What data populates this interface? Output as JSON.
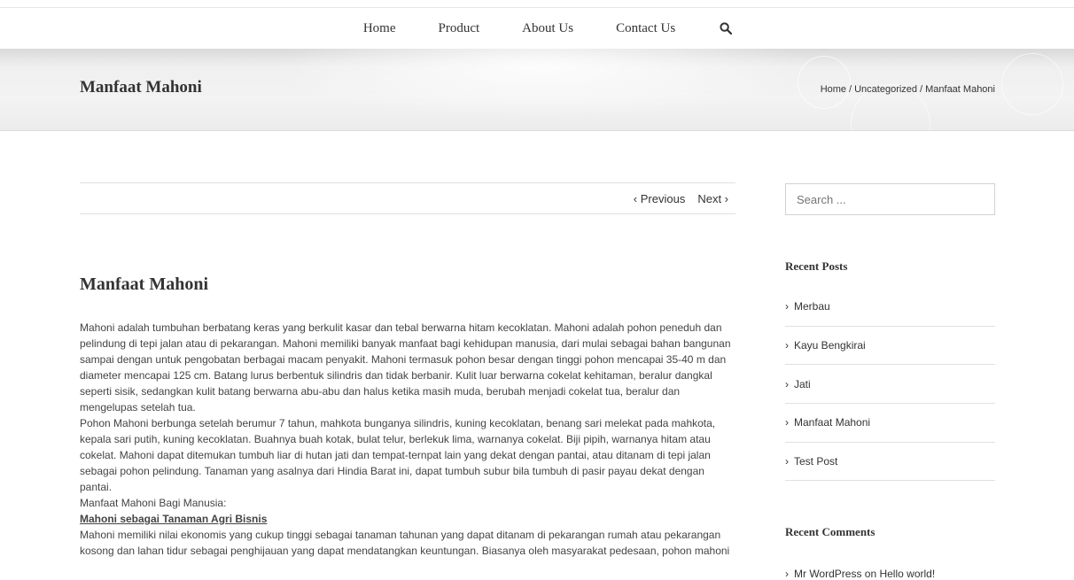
{
  "nav": {
    "items": [
      "Home",
      "Product",
      "About Us",
      "Contact Us"
    ],
    "search_icon": "search-icon"
  },
  "header": {
    "title": "Manfaat Mahoni",
    "breadcrumb": [
      "Home",
      "Uncategorized",
      "Manfaat Mahoni"
    ],
    "separator": "/"
  },
  "postnav": {
    "previous": "‹ Previous",
    "next": "Next ›"
  },
  "post": {
    "title": "Manfaat Mahoni",
    "paragraph1": "Mahoni adalah tumbuhan berbatang keras yang berkulit kasar dan tebal berwarna hitam kecoklatan. Mahoni adalah pohon peneduh dan pelindung di tepi jalan atau di pekarangan. Mahoni memiliki banyak manfaat bagi kehidupan manusia, dari mulai sebagai bahan bangunan sampai dengan untuk pengobatan berbagai macam penyakit. Mahoni termasuk pohon besar dengan tinggi pohon mencapai 35-40 m dan diameter mencapai 125 cm. Batang lurus berbentuk silindris dan tidak berbanir. Kulit luar berwarna cokelat kehitaman, beralur dangkal seperti sisik, sedangkan kulit batang berwarna abu-abu dan halus ketika masih muda, berubah menjadi cokelat tua, beralur dan mengelupas setelah tua.",
    "paragraph2": "Pohon Mahoni berbunga setelah berumur 7 tahun, mahkota bunganya silindris, kuning kecoklatan, benang sari melekat pada mahkota, kepala sari putih, kuning kecoklatan. Buahnya buah kotak, bulat telur, berlekuk lima, warnanya cokelat. Biji pipih, warnanya hitam atau cokelat. Mahoni dapat ditemukan tumbuh liar di hutan jati dan tempat-ternpat lain yang dekat dengan pantai, atau ditanam di tepi jalan sebagai pohon pelindung. Tanaman yang asalnya dari Hindia Barat ini, dapat tumbuh subur bila tumbuh di pasir payau dekat dengan pantai.",
    "paragraph3": "Manfaat Mahoni Bagi Manusia:",
    "subheading": "Mahoni sebagai Tanaman Agri Bisnis",
    "paragraph4": "Mahoni memiliki nilai ekonomis yang cukup tinggi sebagai tanaman tahunan yang dapat ditanam di pekarangan rumah atau pekarangan kosong dan lahan tidur sebagai penghijauan yang dapat mendatangkan keuntungan. Biasanya oleh masyarakat pedesaan, pohon mahoni"
  },
  "sidebar": {
    "search_placeholder": "Search ...",
    "recent_posts_title": "Recent Posts",
    "recent_posts": [
      "Merbau",
      "Kayu Bengkirai",
      "Jati",
      "Manfaat Mahoni",
      "Test Post"
    ],
    "recent_comments_title": "Recent Comments",
    "comment": "Mr WordPress on Hello world!"
  }
}
